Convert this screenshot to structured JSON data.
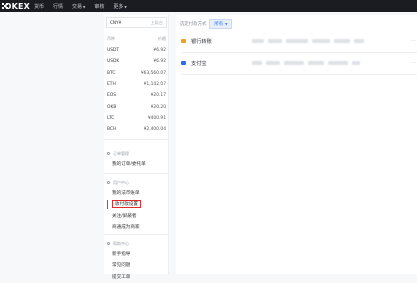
{
  "header": {
    "logo": "OKEX",
    "nav": [
      {
        "label": "货币",
        "caret": false
      },
      {
        "label": "行情",
        "caret": false
      },
      {
        "label": "交易",
        "caret": true
      },
      {
        "label": "审核",
        "caret": false
      },
      {
        "label": "更多",
        "caret": true
      }
    ]
  },
  "sidebar": {
    "currency_select": {
      "value": "CNY¥",
      "hint": "上级台"
    },
    "table_headers": {
      "coin": "币种",
      "price": "价格"
    },
    "rows": [
      {
        "coin": "USDT",
        "price": "¥6.92"
      },
      {
        "coin": "USDK",
        "price": "¥6.92"
      },
      {
        "coin": "BTC",
        "price": "¥63,560.07"
      },
      {
        "coin": "ETH",
        "price": "¥1,142.07"
      },
      {
        "coin": "EOS",
        "price": "¥20.17"
      },
      {
        "coin": "OKB",
        "price": "¥20.20"
      },
      {
        "coin": "LTC",
        "price": "¥400.91"
      },
      {
        "coin": "BCH",
        "price": "¥2,400.04"
      }
    ],
    "groups": [
      {
        "title": "订单管理",
        "links": [
          {
            "label": "我的订单/委托单",
            "active": false
          }
        ]
      },
      {
        "title": "用户中心",
        "links": [
          {
            "label": "我的法币账单",
            "active": false
          },
          {
            "label": "收付款设置",
            "active": true
          },
          {
            "label": "关注/屏蔽者",
            "active": false
          },
          {
            "label": "商通成为商家",
            "active": false
          }
        ]
      },
      {
        "title": "帮助中心",
        "links": [
          {
            "label": "新手指导",
            "active": false
          },
          {
            "label": "常见问题",
            "active": false
          },
          {
            "label": "提交工单",
            "active": false
          }
        ]
      }
    ]
  },
  "main": {
    "filter_label": "选定付款方式",
    "filter_value": "所有",
    "methods": [
      {
        "name": "银行转账",
        "icon_color": "#f0a21b"
      },
      {
        "name": "支付宝",
        "icon_color": "#2a6fe8"
      }
    ]
  }
}
